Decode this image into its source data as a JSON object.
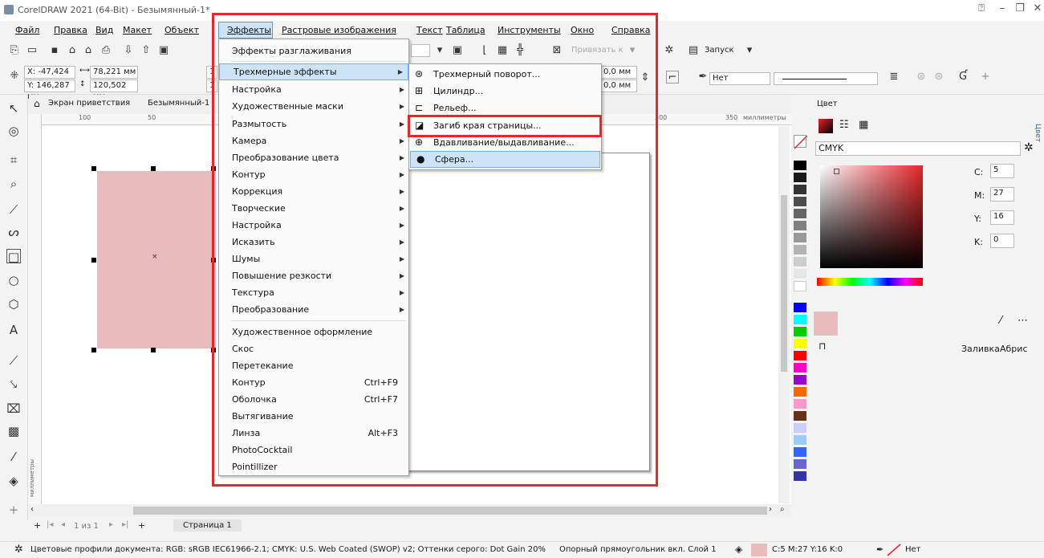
{
  "window": {
    "title": "CorelDRAW 2021 (64-Bit) - Безымянный-1*"
  },
  "menubar": {
    "items": [
      "Файл",
      "Правка",
      "Вид",
      "Макет",
      "Объект",
      "Эффекты",
      "Растровые изображения",
      "Текст",
      "Таблица",
      "Инструменты",
      "Окно",
      "Справка"
    ]
  },
  "toolbar": {
    "snap_label": "Привязать к",
    "launch_label": "Запуск"
  },
  "propbar": {
    "x": "X: -47,424 мм",
    "y": "Y: 146,287 мм",
    "w": "78,221 мм",
    "h": "120,502 мм",
    "w2": "1",
    "h2": "1",
    "off1": "0,0 мм",
    "off2": "0,0 мм",
    "outline_none": "Нет"
  },
  "tabs": {
    "welcome": "Экран приветствия",
    "doc": "Безымянный-1"
  },
  "ruler": {
    "l100": "100",
    "l50": "50",
    "l300": "300",
    "l350": "350",
    "units": "миллиметры",
    "vunits": "миллиметры"
  },
  "effects_menu": {
    "items": [
      {
        "label": "Эффекты разглаживания"
      },
      {
        "label": "Трехмерные эффекты",
        "sub": true
      },
      {
        "label": "Настройка",
        "sub": true
      },
      {
        "label": "Художественные маски",
        "sub": true
      },
      {
        "label": "Размытость",
        "sub": true
      },
      {
        "label": "Камера",
        "sub": true
      },
      {
        "label": "Преобразование цвета",
        "sub": true
      },
      {
        "label": "Контур",
        "sub": true
      },
      {
        "label": "Коррекция",
        "sub": true
      },
      {
        "label": "Творческие",
        "sub": true
      },
      {
        "label": "Настройка",
        "sub": true
      },
      {
        "label": "Исказить",
        "sub": true
      },
      {
        "label": "Шумы",
        "sub": true
      },
      {
        "label": "Повышение резкости",
        "sub": true
      },
      {
        "label": "Текстура",
        "sub": true
      },
      {
        "label": "Преобразование",
        "sub": true
      },
      {
        "label": "Художественное оформление"
      },
      {
        "label": "Скос"
      },
      {
        "label": "Перетекание"
      },
      {
        "label": "Контур",
        "shortcut": "Ctrl+F9"
      },
      {
        "label": "Оболочка",
        "shortcut": "Ctrl+F7"
      },
      {
        "label": "Вытягивание"
      },
      {
        "label": "Линза",
        "shortcut": "Alt+F3"
      },
      {
        "label": "PhotoCocktail"
      },
      {
        "label": "Pointillizer"
      }
    ]
  },
  "submenu_3d": {
    "items": [
      {
        "label": "Трехмерный поворот...",
        "icon": "rotate-3d-icon"
      },
      {
        "label": "Цилиндр...",
        "icon": "cylinder-icon"
      },
      {
        "label": "Рельеф...",
        "icon": "emboss-icon"
      },
      {
        "label": "Загиб края страницы...",
        "icon": "page-curl-icon"
      },
      {
        "label": "Вдавливание/выдавливание...",
        "icon": "pinch-punch-icon"
      },
      {
        "label": "Сфера...",
        "icon": "sphere-icon"
      }
    ]
  },
  "color_docker": {
    "title": "Цвет",
    "model": "CMYK",
    "c_label": "C:",
    "c": "5",
    "m_label": "M:",
    "m": "27",
    "y_label": "Y:",
    "y": "16",
    "k_label": "K:",
    "k": "0",
    "fill": "Заливка",
    "outline": "Абрис",
    "tab": "Цвет"
  },
  "pagenav": {
    "pages": "1 из 1",
    "page_tab": "Страница 1"
  },
  "status": {
    "profiles": "Цветовые профили документа: RGB: sRGB IEC61966-2.1; CMYK: U.S. Web Coated (SWOP) v2; Оттенки серого: Dot Gain 20%",
    "object": "Опорный прямоугольник вкл. Слой 1",
    "fill_values": "C:5 M:27 Y:16 K:0",
    "outline": "Нет"
  },
  "colors": {
    "accent_red": "#e5262a",
    "selection_fill": "#e8bcbc",
    "highlight": "#cde4f7"
  }
}
